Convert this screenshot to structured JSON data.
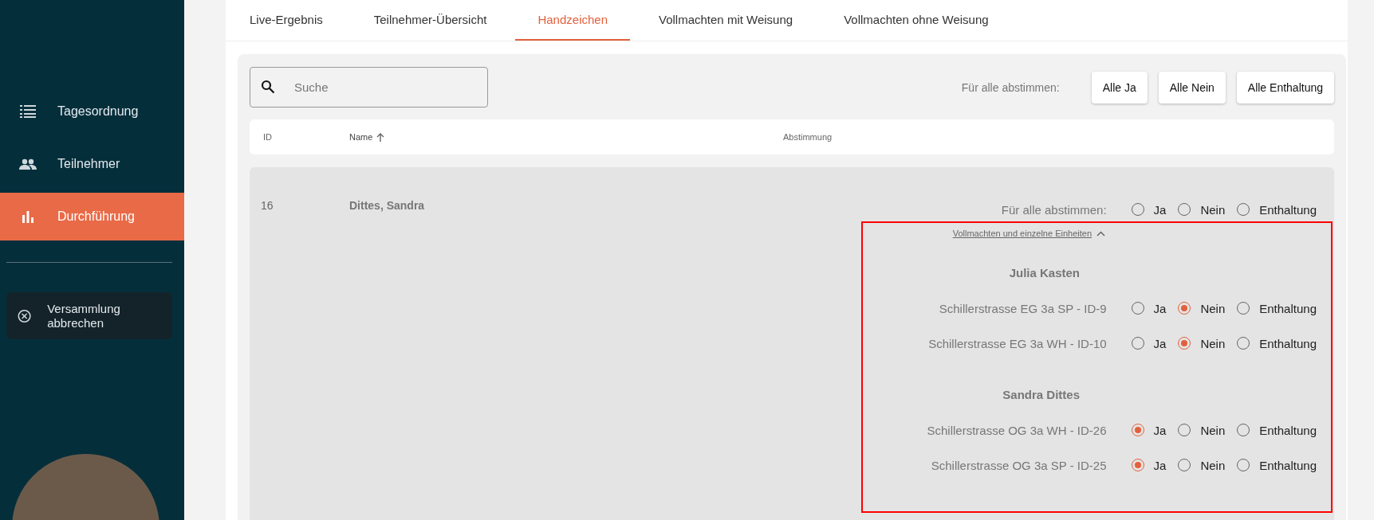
{
  "sidebar": {
    "items": [
      {
        "label": "Tagesordnung",
        "kind": "list",
        "selected": false
      },
      {
        "label": "Teilnehmer",
        "kind": "people",
        "selected": false
      },
      {
        "label": "Durchführung",
        "kind": "chart",
        "selected": true
      }
    ],
    "cancel_button": "Versammlung abbrechen"
  },
  "tabs": [
    {
      "label": "Live-Ergebnis",
      "selected": false
    },
    {
      "label": "Teilnehmer-Übersicht",
      "selected": false
    },
    {
      "label": "Handzeichen",
      "selected": true
    },
    {
      "label": "Vollmachten mit Weisung",
      "selected": false
    },
    {
      "label": "Vollmachten ohne Weisung",
      "selected": false
    }
  ],
  "search": {
    "placeholder": "Suche"
  },
  "vote_all": {
    "label": "Für alle abstimmen:",
    "buttons": [
      "Alle Ja",
      "Alle Nein",
      "Alle Enthaltung"
    ]
  },
  "table": {
    "columns": [
      {
        "label": "ID",
        "sorted": false
      },
      {
        "label": "Name",
        "sorted": true
      },
      {
        "label": "Abstimmung",
        "sorted": false
      }
    ],
    "rows": [
      {
        "id": "16",
        "name": "Dittes, Sandra",
        "vote_all_label": "Für alle abstimmen:",
        "options": [
          {
            "label": "Ja",
            "selected": false
          },
          {
            "label": "Nein",
            "selected": false
          },
          {
            "label": "Enthaltung",
            "selected": false
          }
        ],
        "details_link": {
          "label": "Vollmachten und einzelne Einheiten",
          "expanded": true
        },
        "groups": [
          {
            "name": "Julia Kasten",
            "units": [
              {
                "label": "Schillerstrasse EG 3a SP - ID-9",
                "options": [
                  {
                    "label": "Ja",
                    "selected": false
                  },
                  {
                    "label": "Nein",
                    "selected": true
                  },
                  {
                    "label": "Enthaltung",
                    "selected": false
                  }
                ]
              },
              {
                "label": "Schillerstrasse EG 3a WH - ID-10",
                "options": [
                  {
                    "label": "Ja",
                    "selected": false
                  },
                  {
                    "label": "Nein",
                    "selected": true
                  },
                  {
                    "label": "Enthaltung",
                    "selected": false
                  }
                ]
              }
            ]
          },
          {
            "name": "Sandra Dittes",
            "units": [
              {
                "label": "Schillerstrasse OG 3a WH - ID-26",
                "options": [
                  {
                    "label": "Ja",
                    "selected": true
                  },
                  {
                    "label": "Nein",
                    "selected": false
                  },
                  {
                    "label": "Enthaltung",
                    "selected": false
                  }
                ]
              },
              {
                "label": "Schillerstrasse OG 3a SP - ID-25",
                "options": [
                  {
                    "label": "Ja",
                    "selected": true
                  },
                  {
                    "label": "Nein",
                    "selected": false
                  },
                  {
                    "label": "Enthaltung",
                    "selected": false
                  }
                ]
              }
            ]
          }
        ]
      }
    ]
  }
}
